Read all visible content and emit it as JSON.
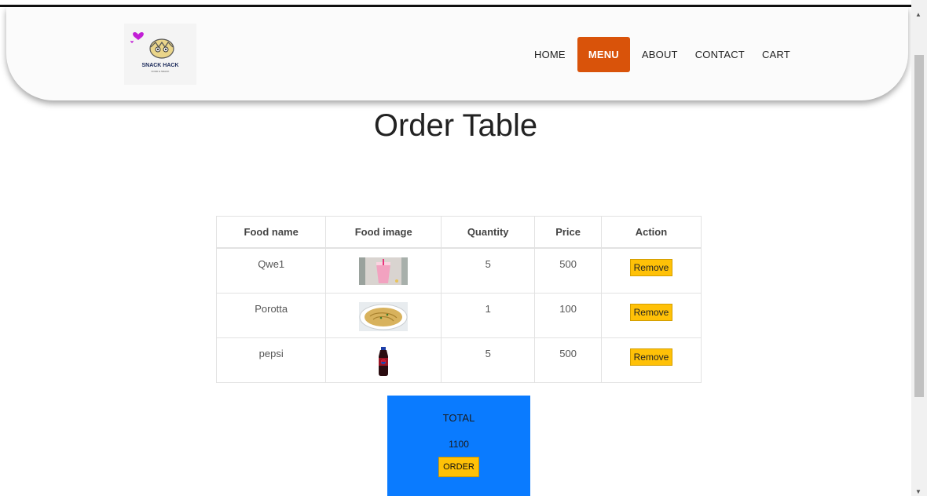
{
  "brand": {
    "logo_text": "SNACK HACK",
    "logo_tagline": "FOOD & SNACK"
  },
  "nav": {
    "items": [
      {
        "label": "HOME"
      },
      {
        "label": "MENU"
      },
      {
        "label": "ABOUT"
      },
      {
        "label": "CONTACT"
      },
      {
        "label": "CART"
      }
    ],
    "active": "MENU"
  },
  "page_title": "Order Table",
  "table": {
    "headers": [
      "Food name",
      "Food image",
      "Quantity",
      "Price",
      "Action"
    ],
    "rows": [
      {
        "name": "Qwe1",
        "image": "pink-drink-image",
        "quantity": "5",
        "price": "500",
        "action": "Remove"
      },
      {
        "name": "Porotta",
        "image": "porotta-plate-image",
        "quantity": "1",
        "price": "100",
        "action": "Remove"
      },
      {
        "name": "pepsi",
        "image": "pepsi-bottle-image",
        "quantity": "5",
        "price": "500",
        "action": "Remove"
      }
    ]
  },
  "total": {
    "label": "TOTAL",
    "value": "1100",
    "order_label": "ORDER"
  },
  "colors": {
    "accent": "#d9530a",
    "button": "#ffc107",
    "total_box": "#0a7bff"
  }
}
